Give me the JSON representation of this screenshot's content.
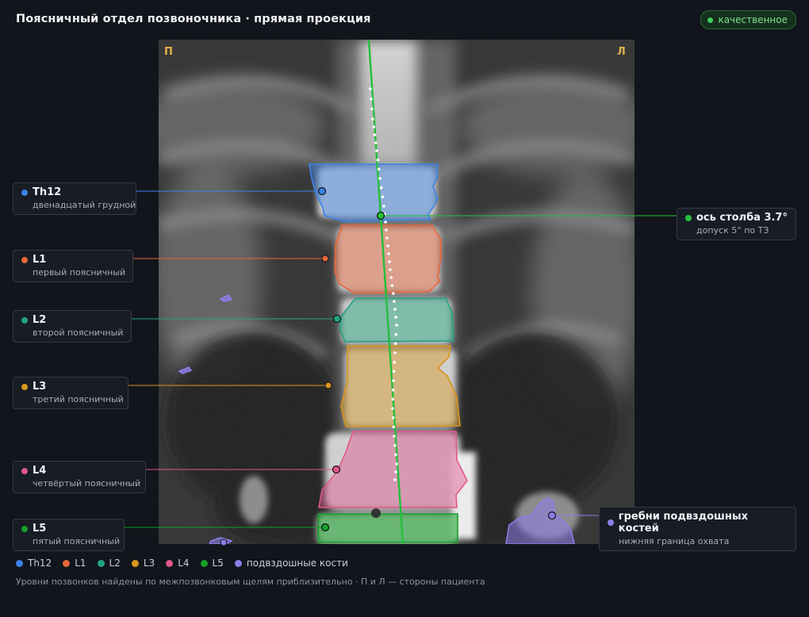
{
  "header": {
    "title": "Поясничный отдел позвоночника · прямая проекция",
    "quality_badge": "качественное"
  },
  "viewer": {
    "side_right_of_patient": "П",
    "side_left_of_patient": "Л"
  },
  "colors": {
    "th12": "#3b82e6",
    "l1": "#e8663a",
    "l2": "#22a37f",
    "l3": "#d9961e",
    "l4": "#e0578c",
    "l5": "#16a02a",
    "iliac": "#8b7ee8",
    "axis": "#22c03a",
    "side_marker": "#e3b34a"
  },
  "labels": {
    "th12": {
      "name": "Th12",
      "sub": "двенадцатый грудной"
    },
    "l1": {
      "name": "L1",
      "sub": "первый поясничный"
    },
    "l2": {
      "name": "L2",
      "sub": "второй поясничный"
    },
    "l3": {
      "name": "L3",
      "sub": "третий поясничный"
    },
    "l4": {
      "name": "L4",
      "sub": "четвёртый поясничный"
    },
    "l5": {
      "name": "L5",
      "sub": "пятый поясничный"
    },
    "axis": {
      "name": "ось столба 3.7°",
      "sub": "допуск 5° по ТЗ"
    },
    "iliac": {
      "name": "гребни подвздошных костей",
      "sub": "нижняя граница охвата"
    }
  },
  "legend": [
    {
      "key": "th12",
      "label": "Th12"
    },
    {
      "key": "l1",
      "label": "L1"
    },
    {
      "key": "l2",
      "label": "L2"
    },
    {
      "key": "l3",
      "label": "L3"
    },
    {
      "key": "l4",
      "label": "L4"
    },
    {
      "key": "l5",
      "label": "L5"
    },
    {
      "key": "iliac",
      "label": "подвздошные кости"
    }
  ],
  "footnote": "Уровни позвонков найдены по межпозвонковым щелям приблизительно · П и Л — стороны пациента"
}
